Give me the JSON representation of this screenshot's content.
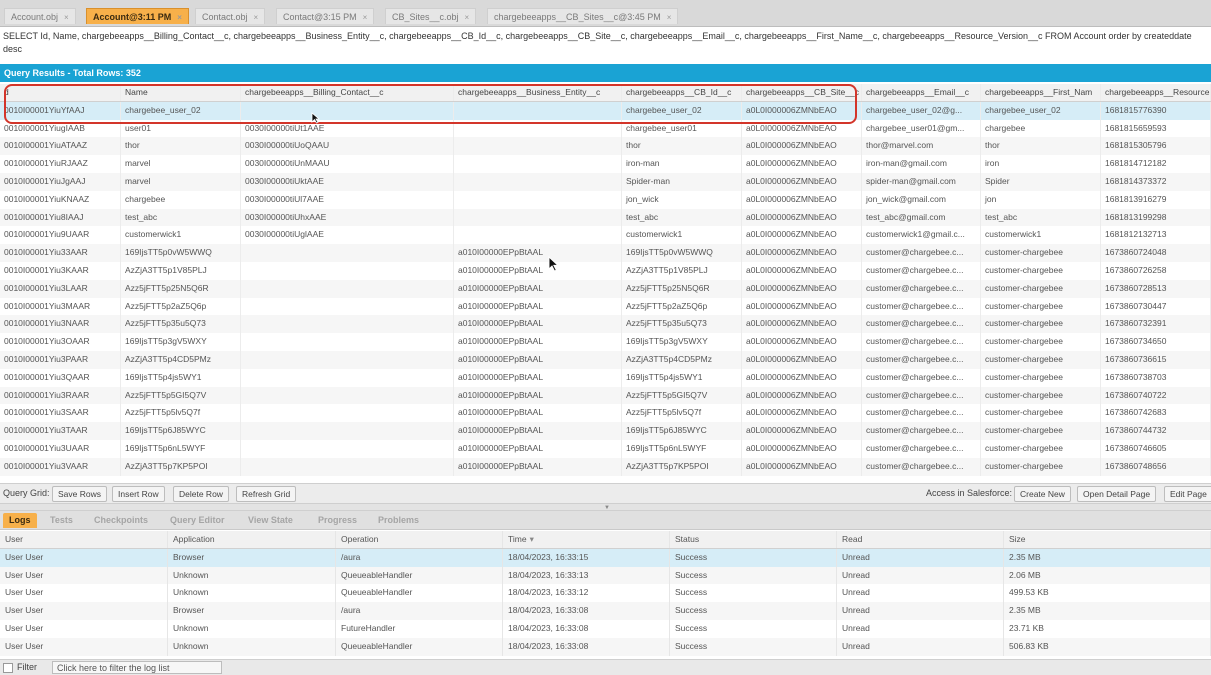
{
  "tabs": [
    {
      "label": "Account.obj",
      "active": false
    },
    {
      "label": "Account@3:11 PM",
      "active": true
    },
    {
      "label": "Contact.obj",
      "active": false
    },
    {
      "label": "Contact@3:15 PM",
      "active": false
    },
    {
      "label": "CB_Sites__c.obj",
      "active": false
    },
    {
      "label": "chargebeeapps__CB_Sites__c@3:45 PM",
      "active": false
    }
  ],
  "tab_close_glyph": "×",
  "query_text": "SELECT Id, Name, chargebeeapps__Billing_Contact__c, chargebeeapps__Business_Entity__c, chargebeeapps__CB_Id__c, chargebeeapps__CB_Site__c, chargebeeapps__Email__c, chargebeeapps__First_Name__c, chargebeeapps__Resource_Version__c FROM Account order by createddate desc",
  "query_results_title": "Query Results - Total Rows: 352",
  "grid": {
    "columns": [
      "Id",
      "Name",
      "chargebeeapps__Billing_Contact__c",
      "chargebeeapps__Business_Entity__c",
      "chargebeeapps__CB_Id__c",
      "chargebeeapps__CB_Site__c",
      "chargebeeapps__Email__c",
      "chargebeeapps__First_Name__c",
      "chargebeeapps__Resource_Version__c"
    ],
    "header_display": [
      "d",
      "Name",
      "chargebeeapps__Billing_Contact__c",
      "chargebeeapps__Business_Entity__c",
      "chargebeeapps__CB_Id__c",
      "chargebeeapps__CB_Site__c",
      "chargebeeapps__Email__c",
      "chargebeeapps__First_Nam",
      "chargebeeapps__Resource"
    ],
    "rows": [
      [
        "0010I00001YiuYfAAJ",
        "chargebee_user_02",
        "",
        "",
        "chargebee_user_02",
        "a0L0I000006ZMNbEAO",
        "chargebee_user_02@g...",
        "chargebee_user_02",
        "1681815776390"
      ],
      [
        "0010I00001YiugIAAB",
        "user01",
        "0030I00000tiUt1AAE",
        "",
        "chargebee_user01",
        "a0L0I000006ZMNbEAO",
        "chargebee_user01@gm...",
        "chargebee",
        "1681815659593"
      ],
      [
        "0010I00001YiuATAAZ",
        "thor",
        "0030I00000tiUoQAAU",
        "",
        "thor",
        "a0L0I000006ZMNbEAO",
        "thor@marvel.com",
        "thor",
        "1681815305796"
      ],
      [
        "0010I00001YiuRJAAZ",
        "marvel",
        "0030I00000tiUnMAAU",
        "",
        "iron-man",
        "a0L0I000006ZMNbEAO",
        "iron-man@gmail.com",
        "iron",
        "1681814712182"
      ],
      [
        "0010I00001YiuJgAAJ",
        "marvel",
        "0030I00000tiUktAAE",
        "",
        "Spider-man",
        "a0L0I000006ZMNbEAO",
        "spider-man@gmail.com",
        "Spider",
        "1681814373372"
      ],
      [
        "0010I00001YiuKNAAZ",
        "chargebee",
        "0030I00000tiUl7AAE",
        "",
        "jon_wick",
        "a0L0I000006ZMNbEAO",
        "jon_wick@gmail.com",
        "jon",
        "1681813916279"
      ],
      [
        "0010I00001Yiu8IAAJ",
        "test_abc",
        "0030I00000tiUhxAAE",
        "",
        "test_abc",
        "a0L0I000006ZMNbEAO",
        "test_abc@gmail.com",
        "test_abc",
        "1681813199298"
      ],
      [
        "0010I00001Yiu9UAAR",
        "customerwick1",
        "0030I00000tiUglAAE",
        "",
        "customerwick1",
        "a0L0I000006ZMNbEAO",
        "customerwick1@gmail.c...",
        "customerwick1",
        "1681812132713"
      ],
      [
        "0010I00001Yiu33AAR",
        "169IjsTT5p0vW5WWQ",
        "",
        "a010I00000EPpBtAAL",
        "169IjsTT5p0vW5WWQ",
        "a0L0I000006ZMNbEAO",
        "customer@chargebee.c...",
        "customer-chargebee",
        "1673860724048"
      ],
      [
        "0010I00001Yiu3KAAR",
        "AzZjA3TT5p1V85PLJ",
        "",
        "a010I00000EPpBtAAL",
        "AzZjA3TT5p1V85PLJ",
        "a0L0I000006ZMNbEAO",
        "customer@chargebee.c...",
        "customer-chargebee",
        "1673860726258"
      ],
      [
        "0010I00001Yiu3LAAR",
        "Azz5jFTT5p25N5Q6R",
        "",
        "a010I00000EPpBtAAL",
        "Azz5jFTT5p25N5Q6R",
        "a0L0I000006ZMNbEAO",
        "customer@chargebee.c...",
        "customer-chargebee",
        "1673860728513"
      ],
      [
        "0010I00001Yiu3MAAR",
        "Azz5jFTT5p2aZ5Q6p",
        "",
        "a010I00000EPpBtAAL",
        "Azz5jFTT5p2aZ5Q6p",
        "a0L0I000006ZMNbEAO",
        "customer@chargebee.c...",
        "customer-chargebee",
        "1673860730447"
      ],
      [
        "0010I00001Yiu3NAAR",
        "Azz5jFTT5p35u5Q73",
        "",
        "a010I00000EPpBtAAL",
        "Azz5jFTT5p35u5Q73",
        "a0L0I000006ZMNbEAO",
        "customer@chargebee.c...",
        "customer-chargebee",
        "1673860732391"
      ],
      [
        "0010I00001Yiu3OAAR",
        "169IjsTT5p3gV5WXY",
        "",
        "a010I00000EPpBtAAL",
        "169IjsTT5p3gV5WXY",
        "a0L0I000006ZMNbEAO",
        "customer@chargebee.c...",
        "customer-chargebee",
        "1673860734650"
      ],
      [
        "0010I00001Yiu3PAAR",
        "AzZjA3TT5p4CD5PMz",
        "",
        "a010I00000EPpBtAAL",
        "AzZjA3TT5p4CD5PMz",
        "a0L0I000006ZMNbEAO",
        "customer@chargebee.c...",
        "customer-chargebee",
        "1673860736615"
      ],
      [
        "0010I00001Yiu3QAAR",
        "169IjsTT5p4js5WY1",
        "",
        "a010I00000EPpBtAAL",
        "169IjsTT5p4js5WY1",
        "a0L0I000006ZMNbEAO",
        "customer@chargebee.c...",
        "customer-chargebee",
        "1673860738703"
      ],
      [
        "0010I00001Yiu3RAAR",
        "Azz5jFTT5p5GI5Q7V",
        "",
        "a010I00000EPpBtAAL",
        "Azz5jFTT5p5GI5Q7V",
        "a0L0I000006ZMNbEAO",
        "customer@chargebee.c...",
        "customer-chargebee",
        "1673860740722"
      ],
      [
        "0010I00001Yiu3SAAR",
        "Azz5jFTT5p5lv5Q7f",
        "",
        "a010I00000EPpBtAAL",
        "Azz5jFTT5p5lv5Q7f",
        "a0L0I000006ZMNbEAO",
        "customer@chargebee.c...",
        "customer-chargebee",
        "1673860742683"
      ],
      [
        "0010I00001Yiu3TAAR",
        "169IjsTT5p6J85WYC",
        "",
        "a010I00000EPpBtAAL",
        "169IjsTT5p6J85WYC",
        "a0L0I000006ZMNbEAO",
        "customer@chargebee.c...",
        "customer-chargebee",
        "1673860744732"
      ],
      [
        "0010I00001Yiu3UAAR",
        "169IjsTT5p6nL5WYF",
        "",
        "a010I00000EPpBtAAL",
        "169IjsTT5p6nL5WYF",
        "a0L0I000006ZMNbEAO",
        "customer@chargebee.c...",
        "customer-chargebee",
        "1673860746605"
      ],
      [
        "0010I00001Yiu3VAAR",
        "AzZjA3TT5p7KP5POI",
        "",
        "a010I00000EPpBtAAL",
        "AzZjA3TT5p7KP5POI",
        "a0L0I000006ZMNbEAO",
        "customer@chargebee.c...",
        "customer-chargebee",
        "1673860748656"
      ]
    ]
  },
  "query_grid_bar": {
    "label": "Query Grid:",
    "buttons": [
      "Save Rows",
      "Insert Row",
      "Delete Row",
      "Refresh Grid"
    ],
    "sf_label": "Access in Salesforce:",
    "sf_buttons": [
      "Create New",
      "Open Detail Page",
      "Edit Page"
    ]
  },
  "bottom_tabs": [
    "Logs",
    "Tests",
    "Checkpoints",
    "Query Editor",
    "View State",
    "Progress",
    "Problems"
  ],
  "log": {
    "columns": [
      "User",
      "Application",
      "Operation",
      "Time",
      "Status",
      "Read",
      "Size"
    ],
    "sort_indicator": "▾",
    "rows": [
      [
        "User User",
        "Browser",
        "/aura",
        "18/04/2023, 16:33:15",
        "Success",
        "Unread",
        "2.35 MB"
      ],
      [
        "User User",
        "Unknown",
        "QueueableHandler",
        "18/04/2023, 16:33:13",
        "Success",
        "Unread",
        "2.06 MB"
      ],
      [
        "User User",
        "Unknown",
        "QueueableHandler",
        "18/04/2023, 16:33:12",
        "Success",
        "Unread",
        "499.53 KB"
      ],
      [
        "User User",
        "Browser",
        "/aura",
        "18/04/2023, 16:33:08",
        "Success",
        "Unread",
        "2.35 MB"
      ],
      [
        "User User",
        "Unknown",
        "FutureHandler",
        "18/04/2023, 16:33:08",
        "Success",
        "Unread",
        "23.71 KB"
      ],
      [
        "User User",
        "Unknown",
        "QueueableHandler",
        "18/04/2023, 16:33:08",
        "Success",
        "Unread",
        "506.83 KB"
      ]
    ]
  },
  "filter": {
    "label": "Filter",
    "placeholder": "Click here to filter the log list"
  },
  "colors": {
    "accent_tab": "#f7b04a",
    "results_header": "#1aa3d4",
    "highlight": "#d3352a",
    "selected_row": "#d6edf7"
  }
}
